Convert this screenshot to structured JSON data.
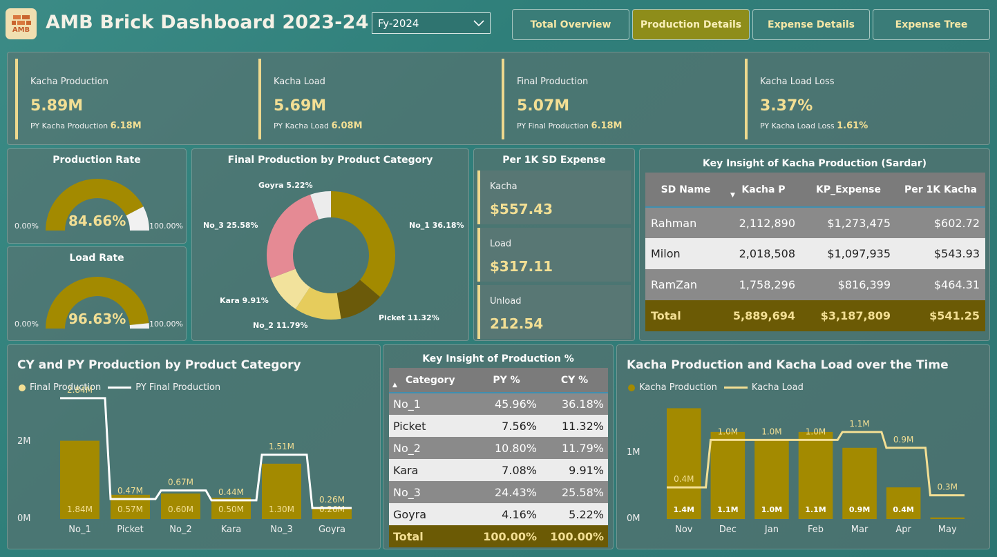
{
  "header": {
    "logo_text": "AMB",
    "title": "AMB Brick Dashboard 2023-24",
    "fy_selected": "Fy-2024",
    "nav": [
      "Total Overview",
      "Production Details",
      "Expense Details",
      "Expense Tree"
    ],
    "nav_active": "Production Details"
  },
  "kpis": [
    {
      "label": "Kacha Production",
      "value": "5.89M",
      "py_label": "PY Kacha Production",
      "py_value": "6.18M"
    },
    {
      "label": "Kacha Load",
      "value": "5.69M",
      "py_label": "PY Kacha Load",
      "py_value": "6.08M"
    },
    {
      "label": "Final Production",
      "value": "5.07M",
      "py_label": "PY Final Production",
      "py_value": "6.18M"
    },
    {
      "label": "Kacha Load Loss",
      "value": "3.37%",
      "py_label": "PY Kacha Load Loss",
      "py_value": "1.61%"
    }
  ],
  "production_rate": {
    "title": "Production Rate",
    "value": "84.66%",
    "fraction": 0.8466,
    "min": "0.00%",
    "max": "100.00%"
  },
  "load_rate": {
    "title": "Load Rate",
    "value": "96.63%",
    "fraction": 0.9663,
    "min": "0.00%",
    "max": "100.00%"
  },
  "donut": {
    "title": "Final Production by Product Category",
    "slices": [
      {
        "name": "No_1",
        "label": "No_1 36.18%",
        "pct": 36.18,
        "color": "#a38a00"
      },
      {
        "name": "Picket",
        "label": "Picket 11.32%",
        "pct": 11.32,
        "color": "#6b5a0a"
      },
      {
        "name": "No_2",
        "label": "No_2 11.79%",
        "pct": 11.79,
        "color": "#e6cc5c"
      },
      {
        "name": "Kara",
        "label": "Kara 9.91%",
        "pct": 9.91,
        "color": "#f2e29c"
      },
      {
        "name": "No_3",
        "label": "No_3 25.58%",
        "pct": 25.58,
        "color": "#e58a94"
      },
      {
        "name": "Goyra",
        "label": "Goyra 5.22%",
        "pct": 5.22,
        "color": "#ececec"
      }
    ]
  },
  "sd_expense": {
    "title": "Per 1K SD Expense",
    "cards": [
      {
        "label": "Kacha",
        "value": "$557.43"
      },
      {
        "label": "Load",
        "value": "$317.11"
      },
      {
        "label": "Unload",
        "value": "212.54"
      }
    ]
  },
  "sardar_table": {
    "title": "Key Insight of Kacha Production (Sardar)",
    "headers": [
      "SD Name",
      "Kacha P",
      "KP_Expense",
      "Per 1K Kacha"
    ],
    "rows": [
      [
        "Rahman",
        "2,112,890",
        "$1,273,475",
        "$602.72"
      ],
      [
        "Milon",
        "2,018,508",
        "$1,097,935",
        "$543.93"
      ],
      [
        "RamZan",
        "1,758,296",
        "$816,399",
        "$464.31"
      ]
    ],
    "total": [
      "Total",
      "5,889,694",
      "$3,187,809",
      "$541.25"
    ]
  },
  "cy_py_chart": {
    "title": "CY and PY Production by Product Category",
    "legend": [
      "Final Production",
      "PY Final Production"
    ],
    "y_ticks": [
      "2M",
      "0M"
    ]
  },
  "prod_table": {
    "title": "Key Insight of Production %",
    "headers": [
      "Category",
      "PY %",
      "CY %"
    ],
    "rows": [
      [
        "No_1",
        "45.96%",
        "36.18%"
      ],
      [
        "Picket",
        "7.56%",
        "11.32%"
      ],
      [
        "No_2",
        "10.80%",
        "11.79%"
      ],
      [
        "Kara",
        "7.08%",
        "9.91%"
      ],
      [
        "No_3",
        "24.43%",
        "25.58%"
      ],
      [
        "Goyra",
        "4.16%",
        "5.22%"
      ]
    ],
    "total": [
      "Total",
      "100.00%",
      "100.00%"
    ]
  },
  "kacha_chart": {
    "title": "Kacha Production and Kacha Load over the Time",
    "legend": [
      "Kacha Production",
      "Kacha Load"
    ],
    "y_ticks": [
      "1M",
      "0M"
    ]
  },
  "chart_data": [
    {
      "type": "bar",
      "title": "CY and PY Production by Product Category",
      "categories": [
        "No_1",
        "Picket",
        "No_2",
        "Kara",
        "No_3",
        "Goyra"
      ],
      "series": [
        {
          "name": "Final Production",
          "kind": "bar",
          "values": [
            1.84,
            0.57,
            0.6,
            0.5,
            1.3,
            0.26
          ],
          "labels": [
            "1.84M",
            "0.57M",
            "0.60M",
            "0.50M",
            "1.30M",
            "0.26M"
          ]
        },
        {
          "name": "PY Final Production",
          "kind": "step-line",
          "values": [
            2.84,
            0.47,
            0.67,
            0.44,
            1.51,
            0.26
          ],
          "labels": [
            "2.84M",
            "0.47M",
            "0.67M",
            "0.44M",
            "1.51M",
            "0.26M"
          ]
        }
      ],
      "ylim": [
        0,
        3.0
      ],
      "unit": "M",
      "colors": {
        "bar": "#a38a00",
        "line": "#ffffff"
      }
    },
    {
      "type": "bar",
      "title": "Kacha Production and Kacha Load over the Time",
      "categories": [
        "Nov",
        "Dec",
        "Jan",
        "Feb",
        "Mar",
        "Apr",
        "May"
      ],
      "series": [
        {
          "name": "Kacha Production",
          "kind": "bar",
          "values": [
            1.4,
            1.1,
            1.0,
            1.1,
            0.9,
            0.4,
            0.02
          ],
          "labels": [
            "1.4M",
            "1.1M",
            "1.0M",
            "1.1M",
            "0.9M",
            "0.4M",
            ""
          ]
        },
        {
          "name": "Kacha Load",
          "kind": "step-line",
          "values": [
            0.4,
            1.0,
            1.0,
            1.0,
            1.1,
            0.9,
            0.3
          ],
          "labels": [
            "0.4M",
            "1.0M",
            "1.0M",
            "1.0M",
            "1.1M",
            "0.9M",
            "0.3M"
          ]
        }
      ],
      "ylim": [
        0,
        1.5
      ],
      "unit": "M",
      "colors": {
        "bar": "#a38a00",
        "line": "#f3df94"
      }
    }
  ]
}
